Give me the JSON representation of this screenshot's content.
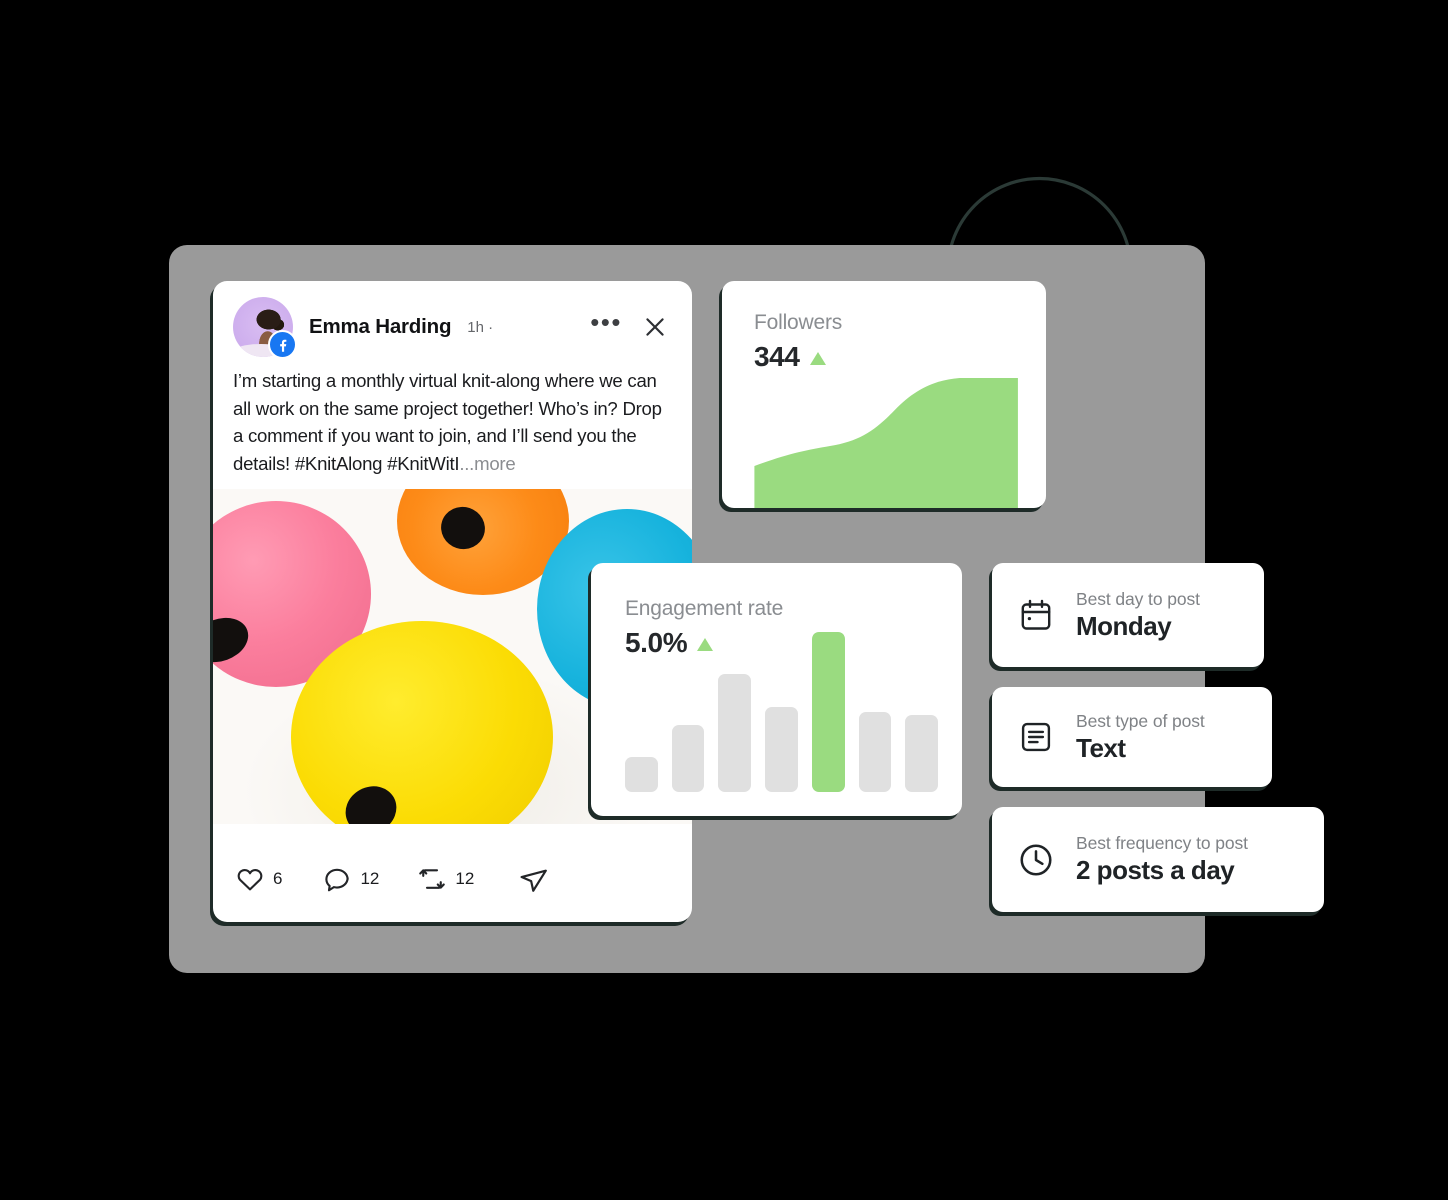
{
  "theme": {
    "background": "#000000",
    "panel_color": "#9a9a9a",
    "card_background": "#ffffff",
    "shadow_color": "#1e2b28",
    "accent_green": "#9adb80",
    "bar_grey": "#e0e0e0",
    "facebook_blue": "#1877f2",
    "avatar_background": "#cfb0ee"
  },
  "post": {
    "author": "Emma Harding",
    "timestamp": "1h ·",
    "platform_badge": "facebook-icon",
    "menu_label": "•••",
    "close_label": "✕",
    "body": "I’m starting a monthly virtual knit-along where we can all work on the same project together! Who’s in? Drop a comment if you want to join, and I’ll send you the details! #KnitAlong #KnitWitI",
    "more_label": "...more",
    "image_alt": "yarn-balls-photo",
    "actions": [
      {
        "icon": "heart-icon",
        "name": "like",
        "count": "6"
      },
      {
        "icon": "comment-icon",
        "name": "comment",
        "count": "12"
      },
      {
        "icon": "repost-icon",
        "name": "repost",
        "count": "12"
      },
      {
        "icon": "share-icon",
        "name": "share",
        "count": ""
      }
    ]
  },
  "followers": {
    "label": "Followers",
    "value": "344",
    "trend": "up"
  },
  "engagement": {
    "label": "Engagement rate",
    "value": "5.0%",
    "trend": "up"
  },
  "insights": [
    {
      "icon": "calendar-icon",
      "label": "Best day to post",
      "value": "Monday"
    },
    {
      "icon": "document-icon",
      "label": "Best type of post",
      "value": "Text"
    },
    {
      "icon": "clock-icon",
      "label": "Best frequency to post",
      "value": "2 posts a day"
    }
  ],
  "decoration": {
    "arrow": "curved-down-arrow"
  },
  "chart_data": [
    {
      "type": "area",
      "title": "Followers",
      "xlabel": "",
      "ylabel": "",
      "x": [
        0,
        1,
        2,
        3,
        4,
        5,
        6,
        7,
        8
      ],
      "values": [
        30,
        34,
        42,
        46,
        52,
        68,
        88,
        97,
        98
      ],
      "ylim": [
        0,
        100
      ],
      "grid": false,
      "legend": "none",
      "series_color": "#9adb80",
      "annotations": [
        "344"
      ]
    },
    {
      "type": "bar",
      "title": "Engagement rate",
      "xlabel": "",
      "ylabel": "",
      "categories": [
        "1",
        "2",
        "3",
        "4",
        "5",
        "6",
        "7"
      ],
      "values": [
        22,
        42,
        74,
        53,
        100,
        50,
        48
      ],
      "highlight_index": 4,
      "ylim": [
        0,
        100
      ],
      "grid": false,
      "legend": "none",
      "bar_color": "#e0e0e0",
      "highlight_color": "#9adb80",
      "annotations": [
        "5.0%"
      ]
    }
  ]
}
